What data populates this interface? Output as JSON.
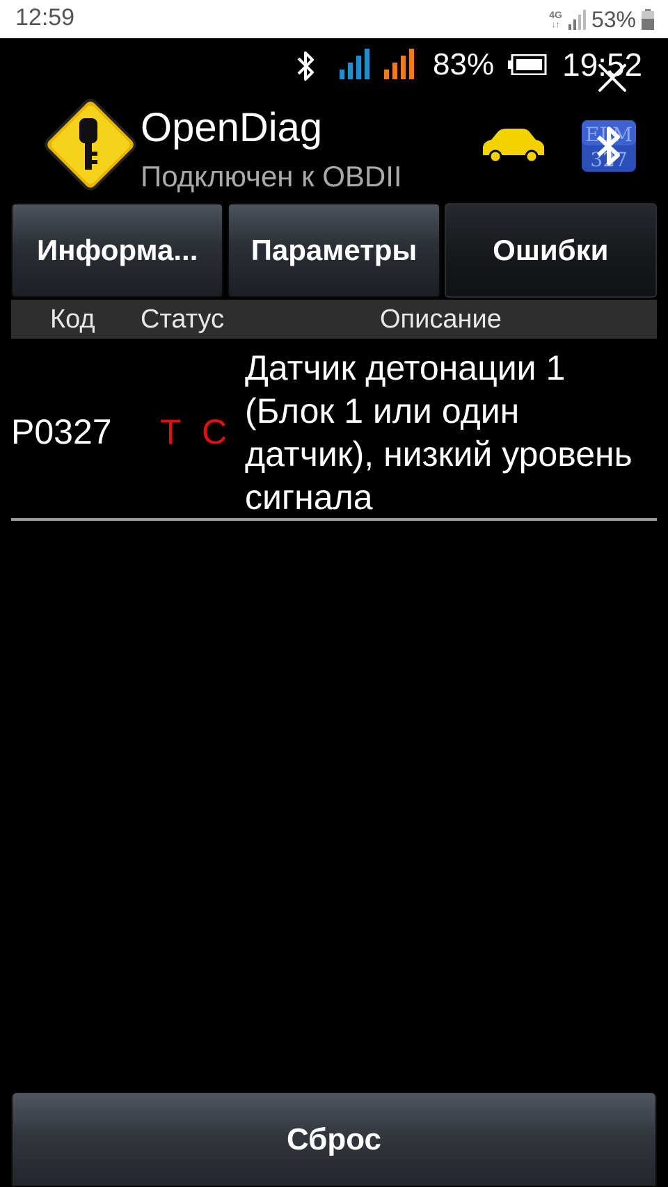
{
  "phone_status": {
    "time": "12:59",
    "network_label": "4G",
    "battery_percent": "53%"
  },
  "device_status": {
    "battery_percent": "83%",
    "time": "19:52"
  },
  "header": {
    "title": "OpenDiag",
    "subtitle": "Подключен к OBDII",
    "elm_icon_text": "ELM 327"
  },
  "tabs": [
    {
      "label": "Информа...",
      "active": false
    },
    {
      "label": "Параметры",
      "active": false
    },
    {
      "label": "Ошибки",
      "active": true
    }
  ],
  "table": {
    "columns": {
      "code": "Код",
      "status": "Статус",
      "description": "Описание"
    },
    "rows": [
      {
        "code": "P0327",
        "status_flags": [
          "T",
          "C"
        ],
        "description": "Датчик детонации 1 (Блок 1 или один датчик), низкий уровень сигнала"
      }
    ]
  },
  "footer": {
    "reset_label": "Сброс"
  },
  "colors": {
    "background": "#000000",
    "status_flag": "#e01010",
    "signal_primary": "#1e8fd5",
    "signal_secondary": "#f07b1a",
    "logo_yellow": "#f5c400",
    "car_yellow": "#f2d200",
    "elm_blue": "#2b4fb8"
  }
}
